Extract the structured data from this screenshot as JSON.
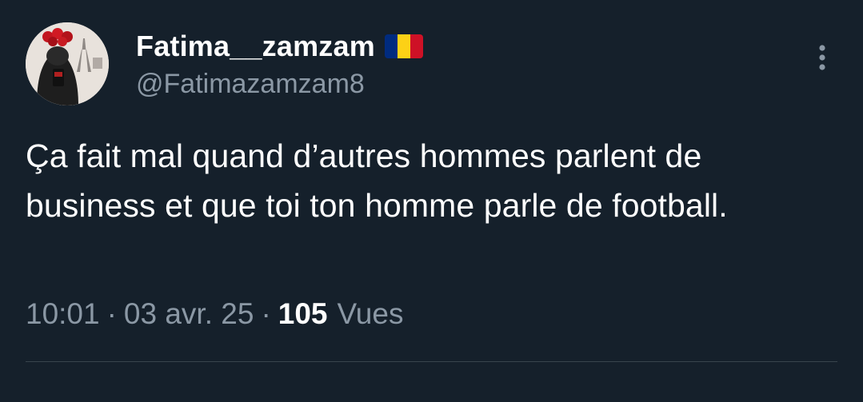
{
  "tweet": {
    "author": {
      "display_name": "Fatima__zamzam",
      "handle": "@Fatimazamzam8",
      "flag": {
        "name": "romania-flag",
        "colors": [
          "#002b7f",
          "#fcd116",
          "#ce1126"
        ]
      },
      "avatar_icon": "avatar"
    },
    "text": "Ça fait mal quand d’autres hommes parlent de business et que toi ton homme parle de football.",
    "meta": {
      "time": "10:01",
      "separator": "·",
      "date": "03 avr. 25",
      "views_count": "105",
      "views_label": "Vues"
    },
    "more_icon": "more-vertical-icon"
  },
  "theme": {
    "background": "#15202b",
    "text": "#ffffff",
    "secondary_text": "#8b98a5",
    "divider": "#38444d"
  }
}
